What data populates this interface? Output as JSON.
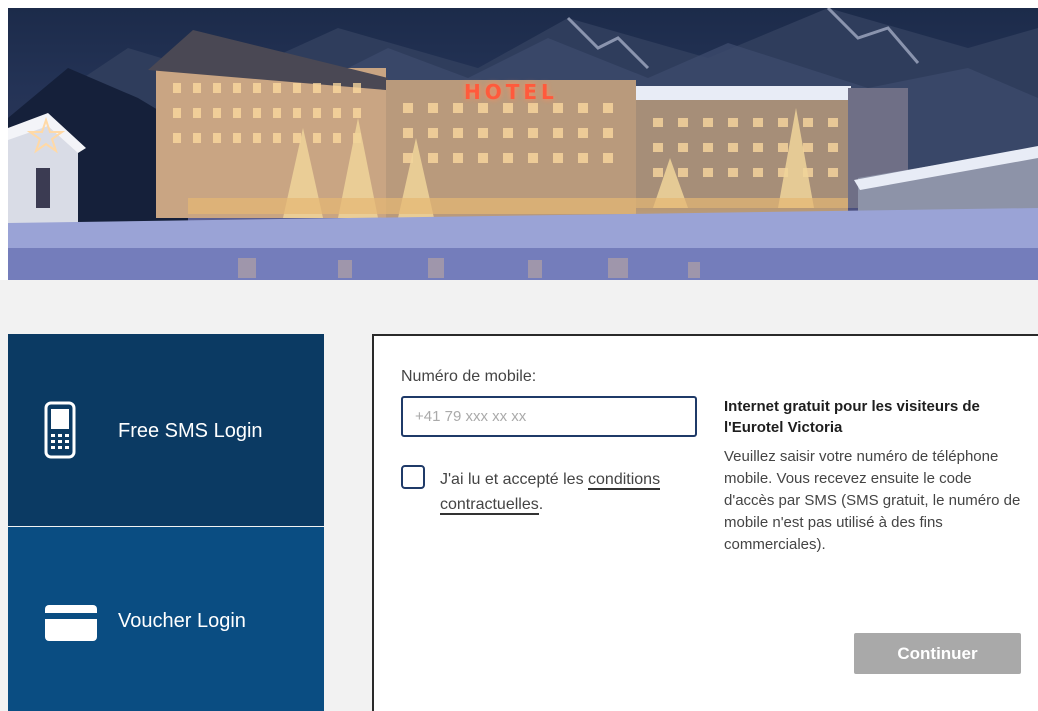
{
  "banner": {
    "hotel_sign": "HOTEL"
  },
  "tiles": {
    "sms": {
      "label": "Free SMS Login",
      "icon": "mobile-phone-icon"
    },
    "voucher": {
      "label": "Voucher Login",
      "icon": "credit-card-icon"
    }
  },
  "form": {
    "mobile_label": "Numéro de mobile:",
    "mobile_placeholder": "+41 79 xxx xx xx",
    "mobile_value": "",
    "terms_prefix": "J'ai lu et accepté les ",
    "terms_link": "conditions contractuelles",
    "terms_suffix": ".",
    "terms_checked": false
  },
  "info": {
    "title": "Internet gratuit pour les visiteurs de l'Eurotel Victoria",
    "text": "Veuillez saisir votre numéro de téléphone mobile. Vous recevez ensuite le code d'accès par SMS (SMS gratuit, le numéro de mobile n'est pas utilisé à des fins commerciales)."
  },
  "actions": {
    "continue_label": "Continuer"
  },
  "colors": {
    "sms_tile": "#0b3a63",
    "voucher_tile": "#0a4d82",
    "continue_button": "#a9a9a9",
    "input_border": "#1f3a68",
    "hotel_sign": "#ff5a3c"
  }
}
